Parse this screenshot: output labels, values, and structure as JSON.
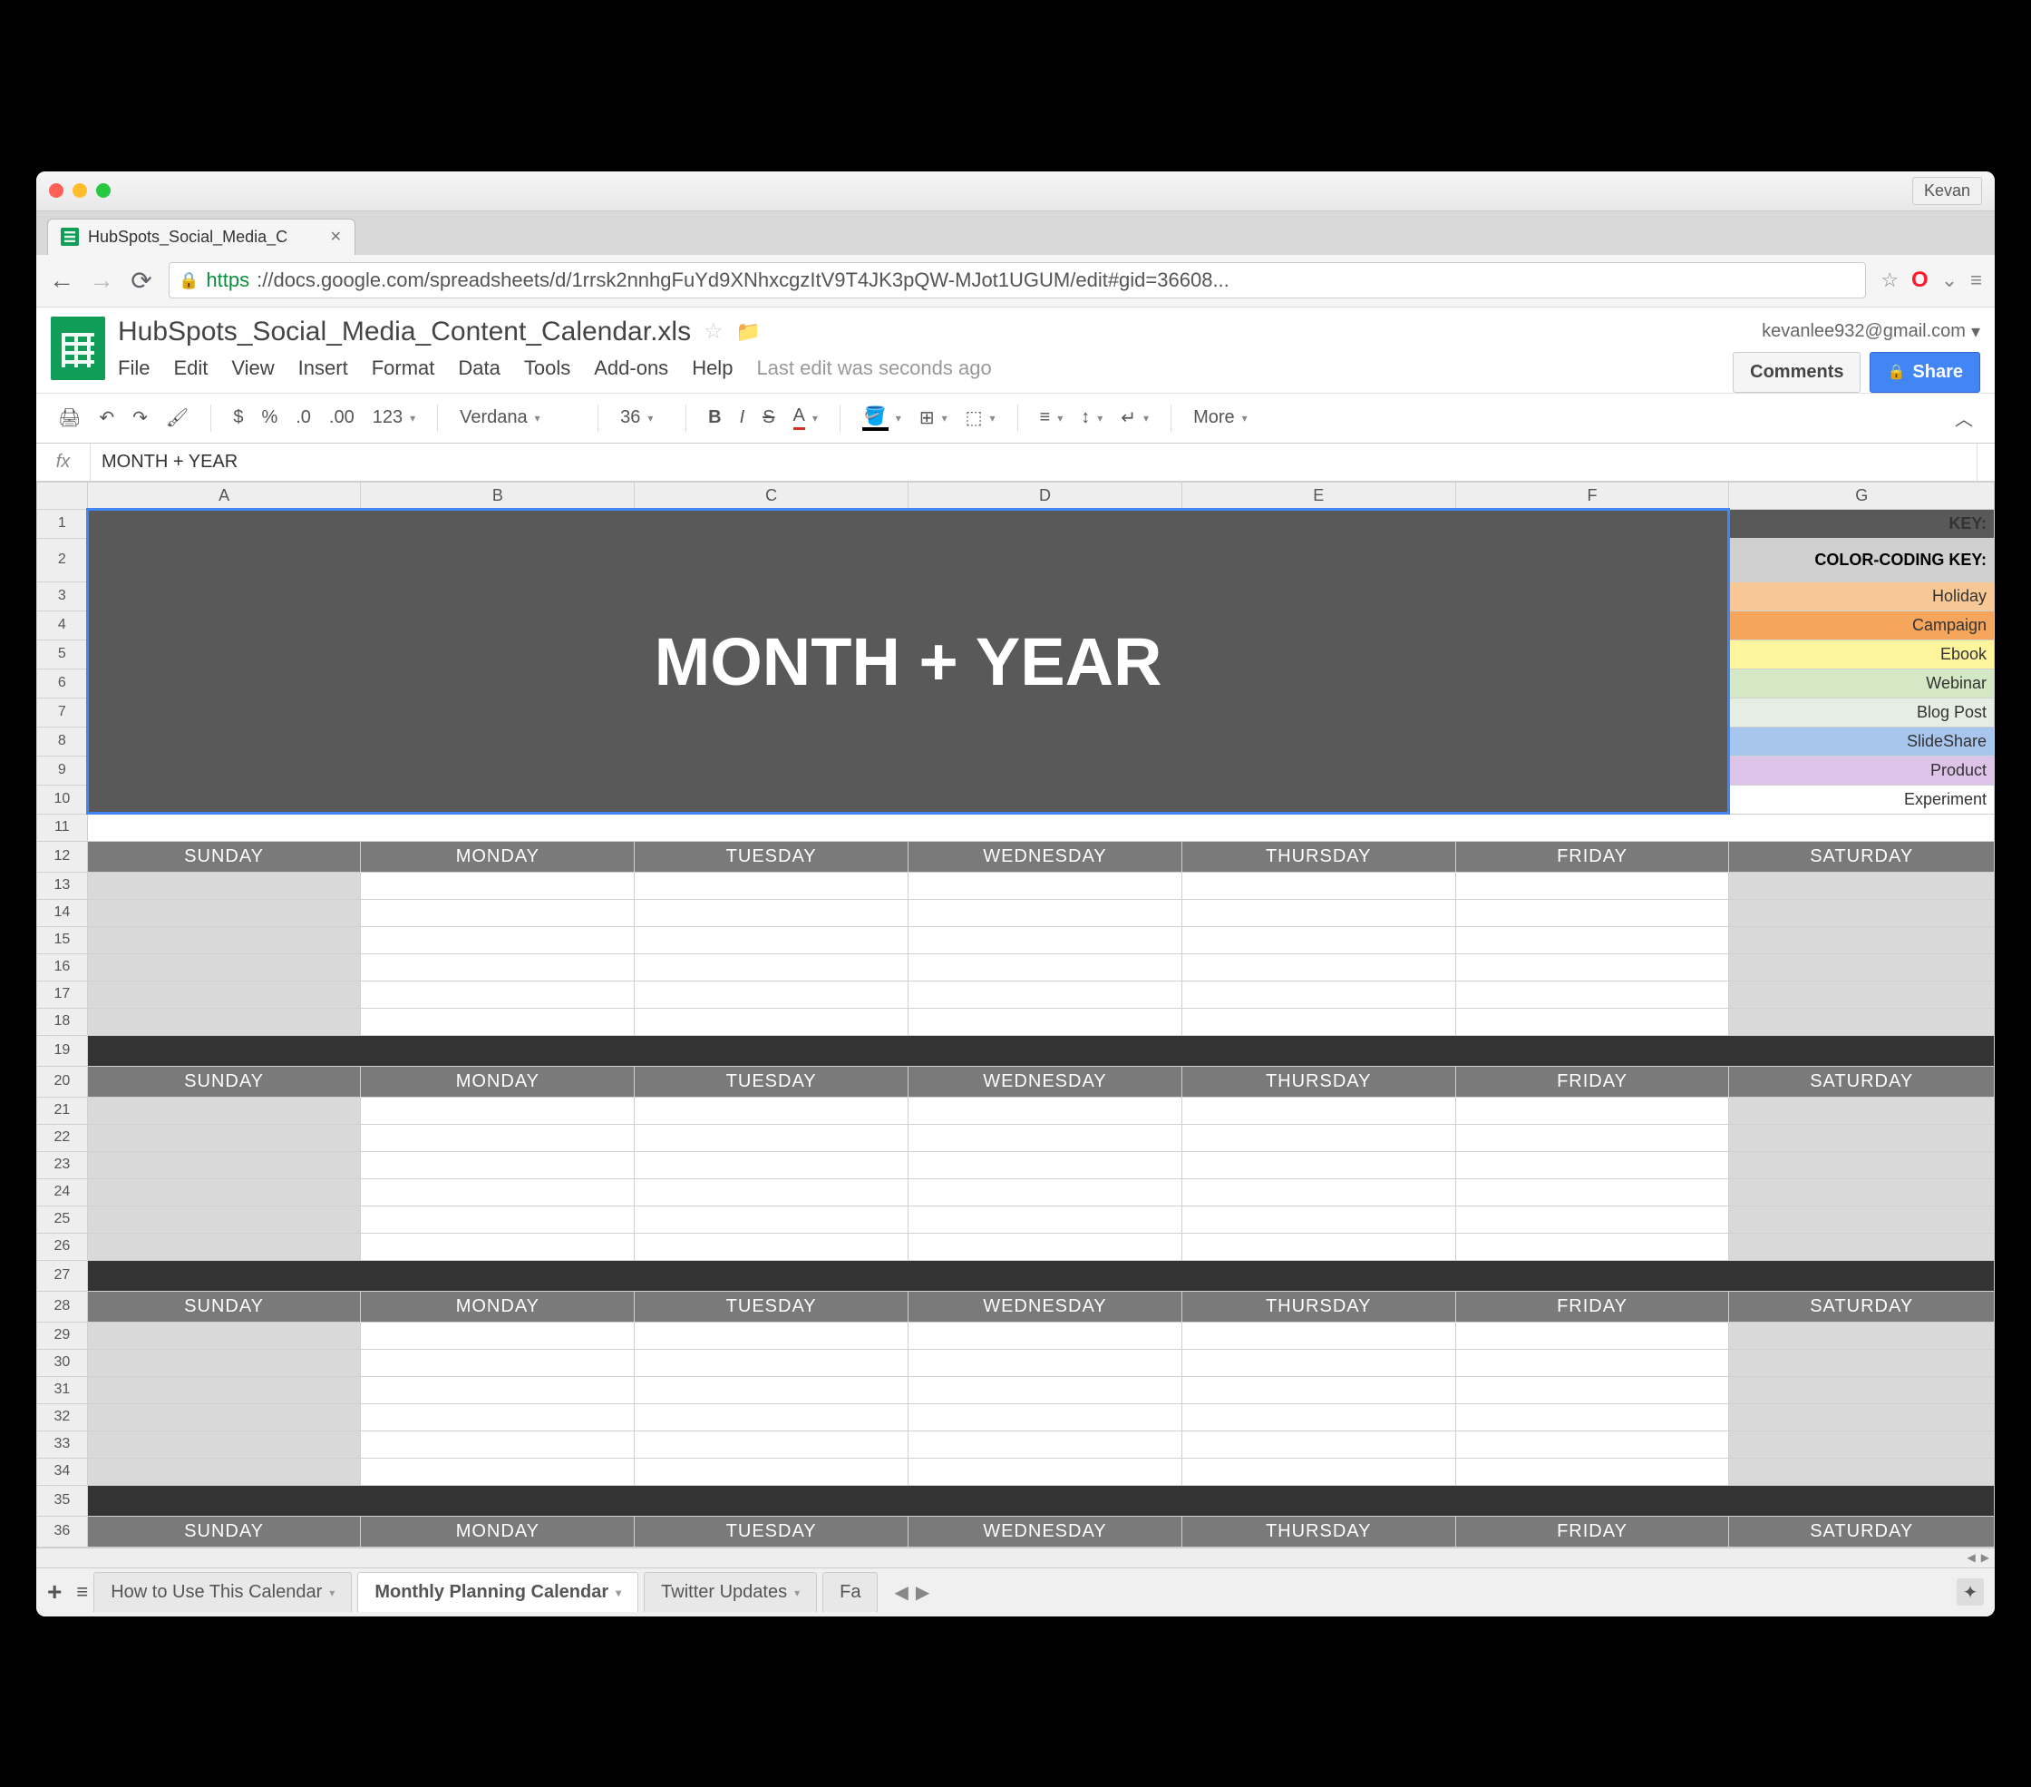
{
  "window": {
    "user_chip": "Kevan"
  },
  "browser": {
    "tab_title": "HubSpots_Social_Media_C",
    "url_https": "https",
    "url_rest": "://docs.google.com/spreadsheets/d/1rrsk2nnhgFuYd9XNhxcgzItV9T4JK3pQW-MJot1UGUM/edit#gid=36608..."
  },
  "docs": {
    "title": "HubSpots_Social_Media_Content_Calendar.xls",
    "email": "kevanlee932@gmail.com",
    "menus": [
      "File",
      "Edit",
      "View",
      "Insert",
      "Format",
      "Data",
      "Tools",
      "Add-ons",
      "Help"
    ],
    "last_edit": "Last edit was seconds ago",
    "comments_btn": "Comments",
    "share_btn": "Share"
  },
  "toolbar": {
    "font": "Verdana",
    "size": "36",
    "more": "More",
    "currency": "$",
    "percent": "%",
    "dec1": ".0",
    "dec2": ".00",
    "num": "123",
    "bold": "B",
    "italic": "I",
    "strike": "S",
    "textcolor": "A"
  },
  "fx": {
    "label": "fx",
    "value": "MONTH + YEAR"
  },
  "columns": [
    "A",
    "B",
    "C",
    "D",
    "E",
    "F",
    "G"
  ],
  "rows": [
    1,
    2,
    3,
    4,
    5,
    6,
    7,
    8,
    9,
    10,
    11,
    12,
    13,
    14,
    15,
    16,
    17,
    18,
    19,
    20,
    21,
    22,
    23,
    24,
    25,
    26,
    27,
    28,
    29,
    30,
    31,
    32,
    33,
    34,
    35,
    36
  ],
  "banner": "MONTH + YEAR",
  "key": {
    "title": "KEY:",
    "subtitle": "COLOR-CODING KEY:",
    "items": [
      "Holiday",
      "Campaign",
      "Ebook",
      "Webinar",
      "Blog Post",
      "SlideShare",
      "Product",
      "Experiment"
    ]
  },
  "days": [
    "SUNDAY",
    "MONDAY",
    "TUESDAY",
    "WEDNESDAY",
    "THURSDAY",
    "FRIDAY",
    "SATURDAY"
  ],
  "sheet_tabs": {
    "t1": "How to Use This Calendar",
    "t2": "Monthly Planning Calendar",
    "t3": "Twitter Updates",
    "t4": "Fa"
  }
}
